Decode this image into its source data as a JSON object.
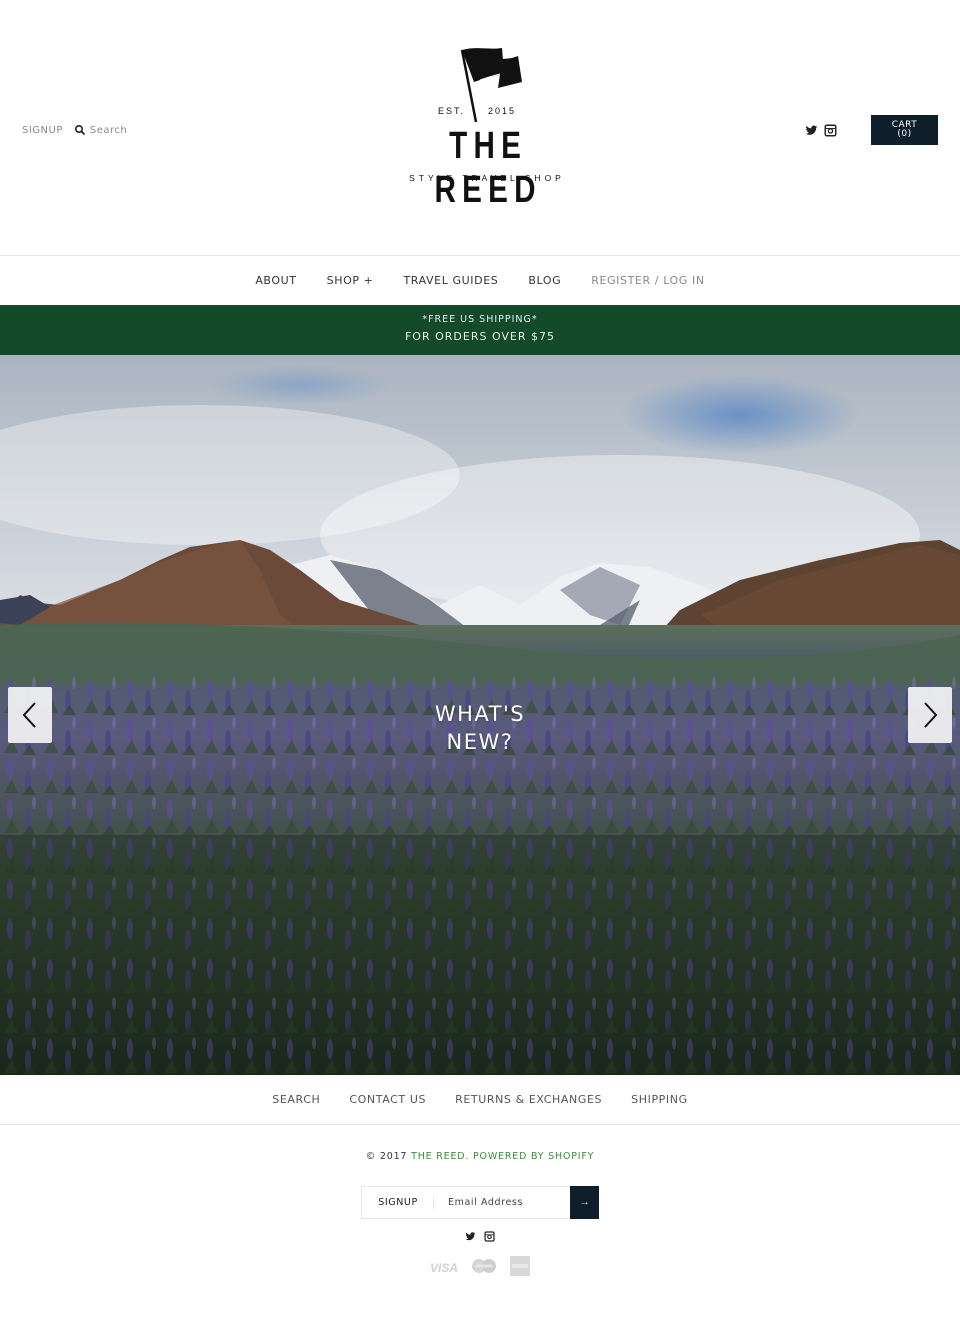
{
  "header": {
    "signup_label": "SIGNUP",
    "search_placeholder": "Search",
    "search_icon": "search-icon",
    "social": [
      "twitter-icon",
      "instagram-icon"
    ],
    "cart_label": "CART",
    "cart_count": "(0)"
  },
  "logo": {
    "est_label": "EST.",
    "year": "2015",
    "title": "THE REED",
    "tagline": "STYLE TRAVEL SHOP",
    "icon": "flag-icon"
  },
  "nav": {
    "items": [
      {
        "label": "ABOUT"
      },
      {
        "label": "SHOP +"
      },
      {
        "label": "TRAVEL GUIDES"
      },
      {
        "label": "BLOG"
      },
      {
        "label": "REGISTER / LOG IN"
      }
    ]
  },
  "promo": {
    "line1": "*FREE US SHIPPING*",
    "line2": "FOR ORDERS OVER $75",
    "background": "#134a2a"
  },
  "hero": {
    "title_line1": "WHAT'S",
    "title_line2": "NEW?",
    "prev_icon": "chevron-left-icon",
    "next_icon": "chevron-right-icon"
  },
  "footer": {
    "links": [
      {
        "label": "SEARCH"
      },
      {
        "label": "CONTACT US"
      },
      {
        "label": "RETURNS & EXCHANGES"
      },
      {
        "label": "SHIPPING"
      }
    ],
    "copyright_prefix": "© 2017",
    "copyright_link": "THE REED. POWERED BY SHOPIFY",
    "newsletter": {
      "label": "SIGNUP",
      "placeholder": "Email Address",
      "submit": "→"
    },
    "social": [
      "twitter-icon",
      "instagram-icon"
    ],
    "payments": [
      "visa-icon",
      "mastercard-icon",
      "amex-icon"
    ]
  },
  "colors": {
    "accent_dark": "#0e1e2a",
    "link_green": "#3e8a3e"
  }
}
